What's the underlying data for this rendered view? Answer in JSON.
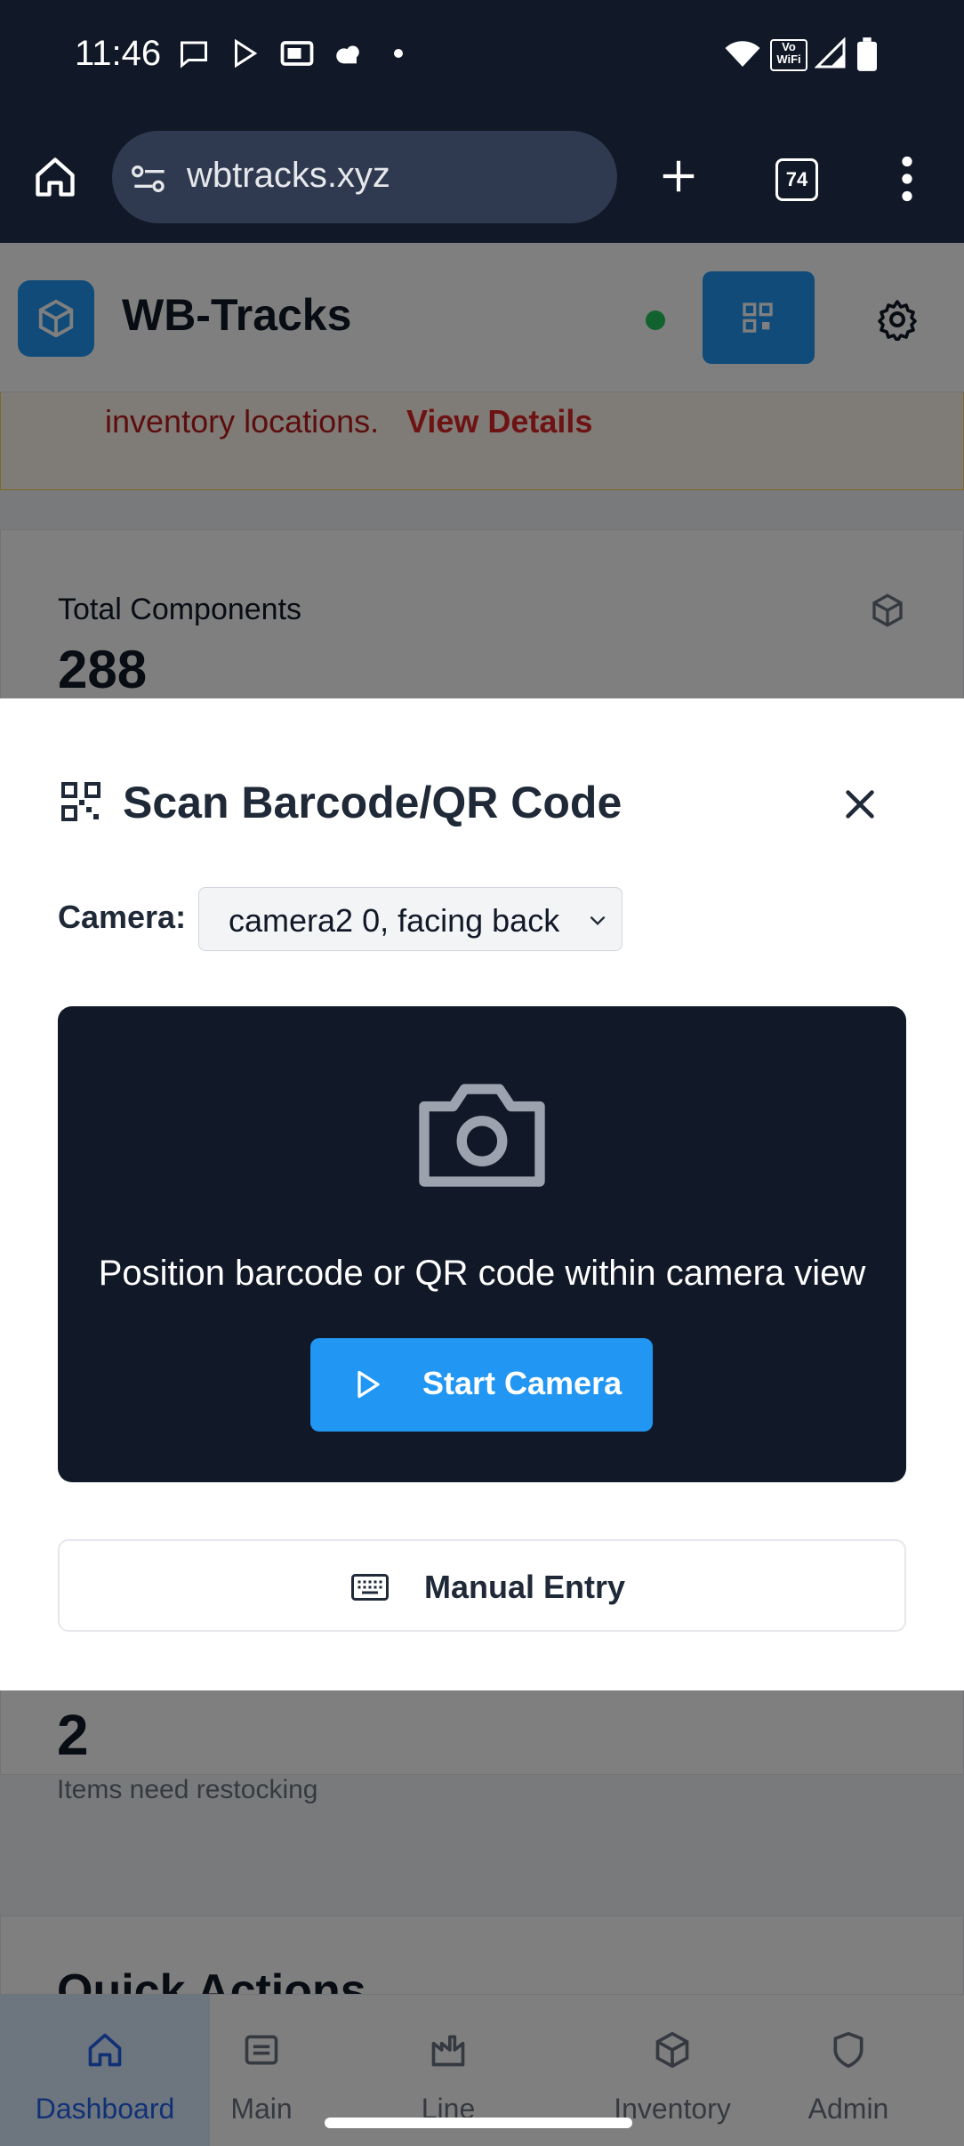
{
  "status_bar": {
    "time": "11:46",
    "icons": [
      "message-icon",
      "play-store-icon",
      "cast-icon",
      "cloud-icon",
      "dot-icon",
      "wifi-icon",
      "vowifi-icon",
      "signal-icon",
      "battery-icon"
    ],
    "vowifi_line1": "Vo",
    "vowifi_line2": "WiFi"
  },
  "browser": {
    "url": "wbtracks.xyz",
    "tab_count": "74"
  },
  "app": {
    "title": "WB-Tracks",
    "alert_text": "inventory locations.",
    "alert_link": "View Details",
    "card_total_label": "Total Components",
    "card_total_value": "288",
    "card_restock_value": "2",
    "card_restock_sub": "Items need restocking",
    "quick_actions_title": "Quick Actions"
  },
  "bottom_nav": [
    {
      "label": "Dashboard",
      "icon": "home-icon",
      "active": true
    },
    {
      "label": "Main",
      "icon": "archive-icon",
      "active": false
    },
    {
      "label": "Line",
      "icon": "factory-icon",
      "active": false
    },
    {
      "label": "Inventory",
      "icon": "package-icon",
      "active": false
    },
    {
      "label": "Admin",
      "icon": "shield-icon",
      "active": false
    }
  ],
  "modal": {
    "title": "Scan Barcode/QR Code",
    "camera_label": "Camera:",
    "camera_selected": "camera2 0, facing back",
    "viewport_text": "Position barcode or QR code within camera view",
    "start_button": "Start Camera",
    "manual_button": "Manual Entry"
  },
  "colors": {
    "accent": "#2196f3",
    "dark": "#111827",
    "alert": "#dc2626",
    "status_ok": "#22c55e"
  }
}
